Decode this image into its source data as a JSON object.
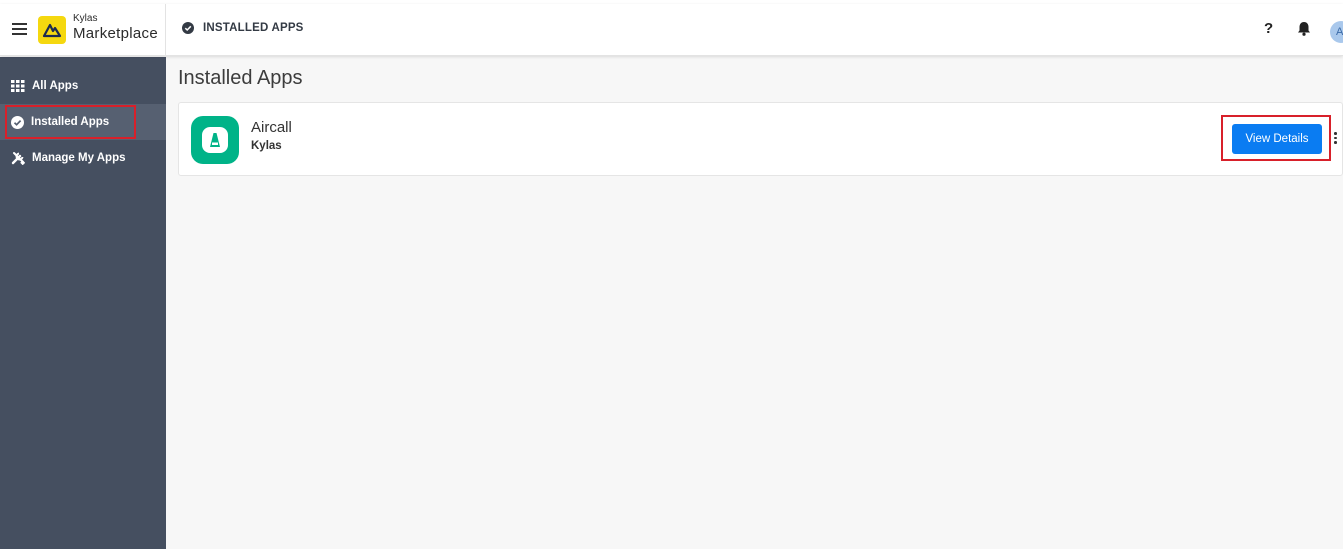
{
  "header": {
    "brand_small": "Kylas",
    "brand_big": "Marketplace",
    "breadcrumb": "INSTALLED APPS",
    "help_label": "?",
    "avatar_initial": "A",
    "icons": {
      "menu": "hamburger-icon",
      "logo": "kylas-logo-icon",
      "crumb": "check-circle-icon",
      "help": "question-icon",
      "bell": "bell-icon"
    }
  },
  "sidebar": {
    "items": [
      {
        "label": "All Apps",
        "icon": "grid-icon",
        "active": false
      },
      {
        "label": "Installed Apps",
        "icon": "check-circle-icon",
        "active": true
      },
      {
        "label": "Manage My Apps",
        "icon": "tools-icon",
        "active": false
      }
    ]
  },
  "main": {
    "title": "Installed Apps",
    "apps": [
      {
        "name": "Aircall",
        "vendor": "Kylas",
        "action_label": "View Details",
        "logo_icon": "aircall-logo-icon"
      }
    ]
  },
  "colors": {
    "sidebar_bg": "#454f60",
    "sidebar_active": "#566071",
    "primary_button": "#0a7cf2",
    "highlight_box": "#d8202a",
    "aircall_green": "#00b388",
    "brand_yellow": "#f5d80f"
  }
}
